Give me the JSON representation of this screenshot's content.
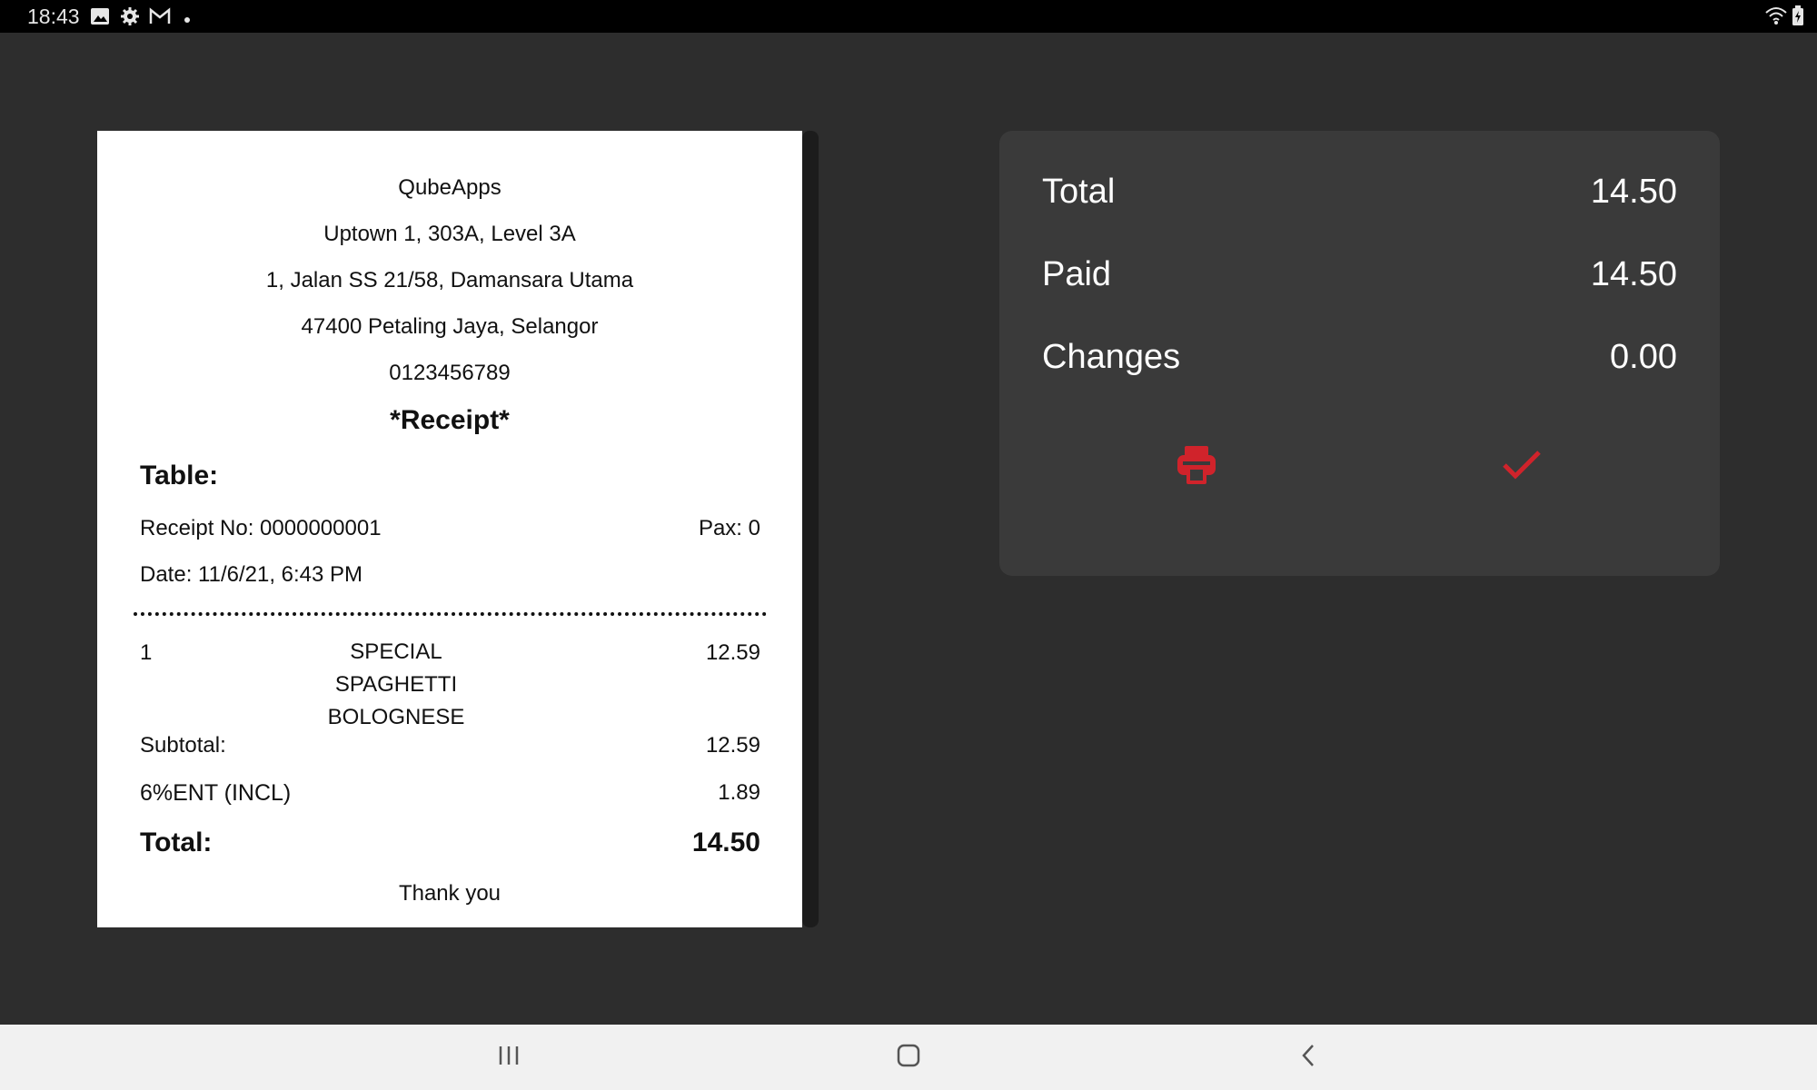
{
  "status_bar": {
    "time": "18:43",
    "left_icons": [
      "image-icon",
      "gear-icon",
      "gmail-icon",
      "dot-icon"
    ],
    "right_icons": [
      "wifi-icon",
      "battery-icon"
    ]
  },
  "receipt": {
    "company": "QubeApps",
    "address_line1": "Uptown 1, 303A, Level 3A",
    "address_line2": "1, Jalan SS 21/58, Damansara Utama",
    "address_line3": "47400 Petaling Jaya, Selangor",
    "phone": "0123456789",
    "title": "*Receipt*",
    "table_label": "Table:",
    "receipt_no": "Receipt No: 0000000001",
    "pax": "Pax: 0",
    "date": "Date: 11/6/21, 6:43 PM",
    "items": [
      {
        "qty": "1",
        "name": "SPECIAL SPAGHETTI BOLOGNESE",
        "amount": "12.59"
      }
    ],
    "subtotal_label": "Subtotal:",
    "subtotal_value": "12.59",
    "tax_label": "6%ENT (INCL)",
    "tax_value": "1.89",
    "total_label": "Total:",
    "total_value": "14.50",
    "footer": "Thank you"
  },
  "payment": {
    "total_label": "Total",
    "total_value": "14.50",
    "paid_label": "Paid",
    "paid_value": "14.50",
    "changes_label": "Changes",
    "changes_value": "0.00",
    "actions": [
      "print-icon",
      "check-icon"
    ],
    "accent_color": "#d0232b"
  },
  "nav_bar": {
    "buttons": [
      "recent-apps-icon",
      "home-icon",
      "back-icon"
    ]
  }
}
